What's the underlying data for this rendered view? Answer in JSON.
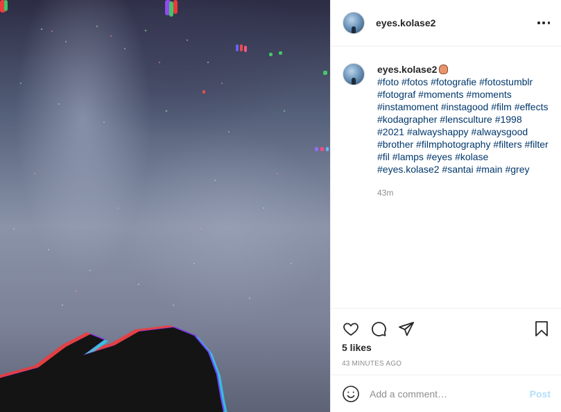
{
  "post": {
    "username": "eyes.kolase2",
    "caption": {
      "username": "eyes.kolase2",
      "emoji_icon": "hand-emoji-icon",
      "hashtags": [
        "#foto",
        "#fotos",
        "#fotografie",
        "#fotostumblr",
        "#fotograf",
        "#moments",
        "#moments",
        "#instamoment",
        "#instagood",
        "#film",
        "#effects",
        "#kodagrapher",
        "#lensculture",
        "#1998",
        "#2021",
        "#alwayshappy",
        "#alwaysgood",
        "#brother",
        "#filmphotography",
        "#filters",
        "#filter",
        "#fil",
        "#lamps",
        "#eyes",
        "#kolase",
        "#eyes.kolase2",
        "#santai",
        "#main",
        "#grey"
      ],
      "timestamp": "43m"
    },
    "likes": "5 likes",
    "posted_ago": "43 MINUTES AGO",
    "comment": {
      "placeholder": "Add a comment…",
      "post_label": "Post"
    }
  },
  "icons": {
    "more": "more-options-icon",
    "like": "heart-icon",
    "comment": "comment-icon",
    "share": "share-icon",
    "save": "bookmark-icon",
    "emoji": "smiley-icon"
  },
  "colors": {
    "hashtag": "#00376b",
    "muted": "#8e8e8e",
    "post_button": "#b2dffc",
    "text": "#262626"
  }
}
